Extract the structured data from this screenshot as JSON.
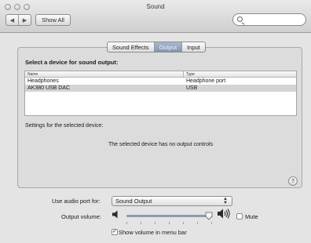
{
  "window": {
    "title": "Sound"
  },
  "toolbar": {
    "back_glyph": "◀",
    "forward_glyph": "▶",
    "show_all_label": "Show All",
    "search": {
      "placeholder": "",
      "value": ""
    }
  },
  "tabs": [
    {
      "label": "Sound Effects",
      "active": false
    },
    {
      "label": "Output",
      "active": true
    },
    {
      "label": "Input",
      "active": false
    }
  ],
  "output": {
    "select_label": "Select a device for sound output:",
    "columns": [
      "Name",
      "Type"
    ],
    "rows": [
      {
        "name": "Headphones",
        "type": "Headphone port",
        "selected": false
      },
      {
        "name": "AK380 USB DAC",
        "type": "USB",
        "selected": true
      }
    ],
    "settings_label": "Settings for the selected device:",
    "no_controls_message": "The selected device has no output controls",
    "help_label": "?"
  },
  "controls": {
    "port_label": "Use audio port for:",
    "port_value": "Sound Output",
    "volume_label": "Output volume:",
    "volume_level": 0.95,
    "mute_label": "Mute",
    "mute_checked": false,
    "menubar_label": "Show volume in menu bar",
    "menubar_checked": true
  },
  "icons": {
    "speaker_low": "speaker-low-icon",
    "speaker_high": "speaker-high-icon",
    "search": "search-icon",
    "help": "help-icon"
  },
  "colors": {
    "active_tab": "#8a9cb8",
    "selection": "#d4d4d4"
  }
}
